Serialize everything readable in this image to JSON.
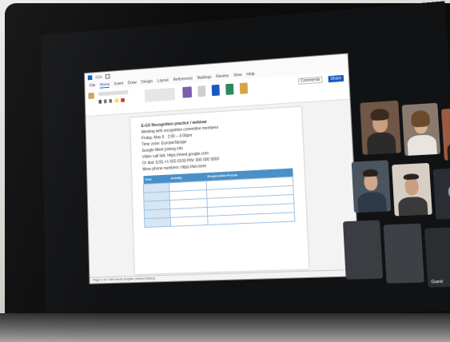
{
  "word": {
    "menu_tabs": [
      "File",
      "Home",
      "Insert",
      "Draw",
      "Design",
      "Layout",
      "References",
      "Mailings",
      "Review",
      "View",
      "Help"
    ],
    "active_tab": "Home",
    "share_label": "Share",
    "comments_label": "Comments",
    "document_lines": [
      "E-GX Recognition practice / webinar",
      "Meeting with recognition committee members",
      "Friday, May 6 · 2:00 – 3:00pm",
      "Time zone: Europe/Skopje",
      "Google Meet joining info",
      "Video call link: https://meet.google.com",
      "Or dial: (US) +1 555 0100  PIN: 000 000 000#",
      "More phone numbers: https://tel.meet"
    ],
    "agenda_headers": [
      "Time",
      "Activity",
      "Responsible Person"
    ],
    "status_left": "Page 1 of 2   480 words   English (United States)"
  },
  "teams": {
    "tiles_with_video": 6,
    "tiles_without_video": 3,
    "blank_tile_caption": "Guest"
  },
  "colors": {
    "word_blue": "#185abd",
    "table_header": "#4a90c8",
    "bezel": "#0c0c0d"
  }
}
